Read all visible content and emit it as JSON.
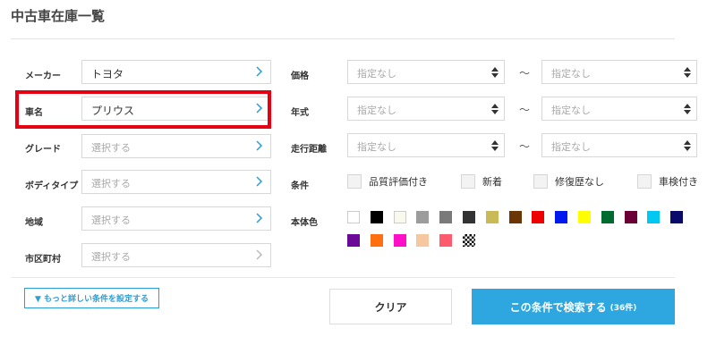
{
  "page": {
    "title": "中古車在庫一覧"
  },
  "left_filters": [
    {
      "label": "メーカー",
      "value": "トヨタ",
      "is_placeholder": false
    },
    {
      "label": "車名",
      "value": "プリウス",
      "is_placeholder": false
    },
    {
      "label": "グレード",
      "value": "選択する",
      "is_placeholder": true
    },
    {
      "label": "ボディタイプ",
      "value": "選択する",
      "is_placeholder": true
    },
    {
      "label": "地域",
      "value": "選択する",
      "is_placeholder": true
    },
    {
      "label": "市区町村",
      "value": "選択する",
      "is_placeholder": true
    }
  ],
  "range_filters": [
    {
      "label": "価格",
      "from": "指定なし",
      "to": "指定なし",
      "separator": "～"
    },
    {
      "label": "年式",
      "from": "指定なし",
      "to": "指定なし",
      "separator": "～"
    },
    {
      "label": "走行距離",
      "from": "指定なし",
      "to": "指定なし",
      "separator": "～"
    }
  ],
  "conditions": {
    "label": "条件",
    "options": [
      "品質評価付き",
      "新着",
      "修復歴なし",
      "車検付き"
    ]
  },
  "body_color": {
    "label": "本体色",
    "swatches": [
      "#ffffff",
      "#000000",
      "#fbf8ee",
      "#9c9c9c",
      "#7a7a7a",
      "#333333",
      "#c9b957",
      "#6b3505",
      "#ee0000",
      "#0019ee",
      "#ffff00",
      "#006b2e",
      "#6b0036",
      "#00c8f0",
      "#0a0a6b",
      "#6b0a96",
      "#ff7010",
      "#ff10c8",
      "#f5c8a0",
      "#ff5a6e",
      "checker"
    ]
  },
  "actions": {
    "more_conditions": "▼ もっと詳しい条件を設定する",
    "clear": "クリア",
    "search": "この条件で検索する",
    "search_count": "(36件)"
  },
  "colors": {
    "accent": "#2ea7e0",
    "highlight": "#e60012"
  }
}
